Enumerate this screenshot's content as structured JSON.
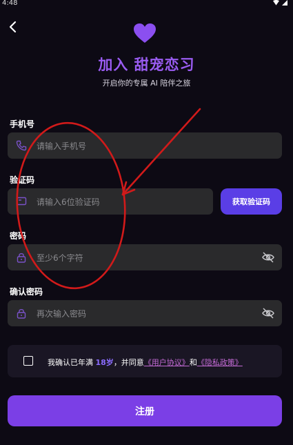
{
  "status_bar": {
    "time": "4:48"
  },
  "header": {
    "title": "加入 甜宠恋习",
    "subtitle": "开启你的专属 AI 陪伴之旅"
  },
  "form": {
    "phone": {
      "label": "手机号",
      "placeholder": "请输入手机号"
    },
    "code": {
      "label": "验证码",
      "placeholder": "请输入6位验证码",
      "button": "获取验证码"
    },
    "password": {
      "label": "密码",
      "placeholder": "至少6个字符"
    },
    "confirm": {
      "label": "确认密码",
      "placeholder": "再次输入密码"
    }
  },
  "agreement": {
    "prefix": "我确认已年满 ",
    "age": "18岁",
    "middle": "，并同意",
    "user_agreement": "《用户协议》",
    "and": "和",
    "privacy_policy": "《隐私政策》"
  },
  "register_button": "注册",
  "colors": {
    "accent": "#7b3fe6",
    "title": "#9a5cf2",
    "annotation": "#d11a1a",
    "background": "#0d0a14"
  }
}
